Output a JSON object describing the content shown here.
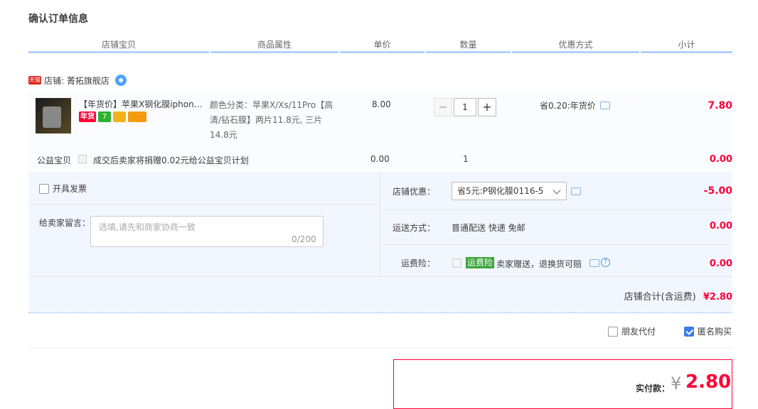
{
  "page_title": "确认订单信息",
  "columns": [
    "店铺宝贝",
    "商品属性",
    "单价",
    "数量",
    "优惠方式",
    "小计"
  ],
  "shop": {
    "badge": "天猫",
    "label": "店铺: 菁拓旗舰店"
  },
  "item": {
    "name": "【年货价】苹果X钢化膜iphone…",
    "tags": {
      "new_year": "年货",
      "seven": "7"
    },
    "attributes": "颜色分类：苹果X/Xs/11Pro【高清/钻石膜】两片11.8元, 三片14.8元",
    "unit_price": "8.00",
    "quantity": "1",
    "discount": "省0.20:年货价",
    "subtotal": "7.80"
  },
  "charity": {
    "label": "公益宝贝",
    "text": "成交后卖家将捐赠0.02元给公益宝贝计划",
    "price": "0.00",
    "qty": "1",
    "subtotal": "0.00"
  },
  "invoice": {
    "label": "开具发票"
  },
  "message": {
    "label": "给卖家留言：",
    "placeholder": "选填,请先和商家协商一致",
    "count": "0/200"
  },
  "shop_discount": {
    "label": "店铺优惠：",
    "selected": "省5元:P钢化膜0116-5",
    "amount": "-5.00"
  },
  "shipping": {
    "label": "运送方式：",
    "value": "普通配送 快递 免邮",
    "amount": "0.00"
  },
  "insurance": {
    "label": "运费险：",
    "badge": "运费险",
    "text": "卖家赠送，退换货可赔",
    "amount": "0.00"
  },
  "shop_total": {
    "label": "店铺合计(含运费)",
    "amount": "¥2.80"
  },
  "options": {
    "friend_pay": "朋友代付",
    "anonymous": "匿名购买"
  },
  "payment": {
    "label": "实付款：",
    "yen": "¥",
    "amount": "2.80"
  }
}
